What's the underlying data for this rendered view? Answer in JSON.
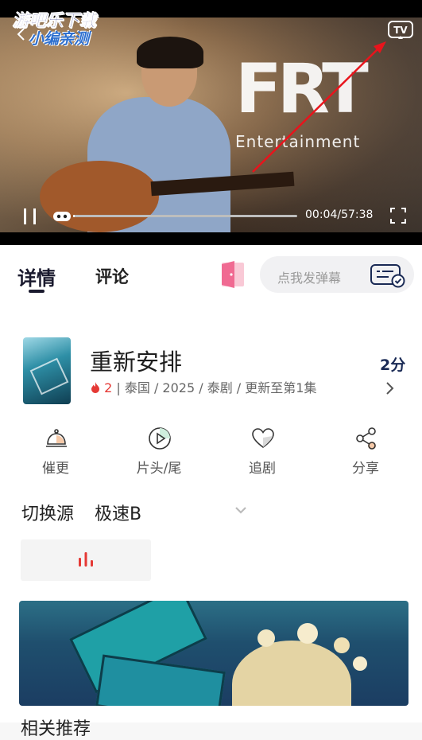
{
  "watermark": {
    "line1": "游吧乐下载",
    "line2": "小编亲测"
  },
  "video": {
    "logo_text": "FRT",
    "logo_subtext": "Entertainment",
    "time": "00:04/57:38",
    "progress_fraction": 0.0012,
    "tv_label": "TV"
  },
  "tabs": {
    "detail": "详情",
    "comment": "评论"
  },
  "danmaku": {
    "placeholder": "点我发弹幕"
  },
  "show": {
    "title": "重新安排",
    "score": "2分",
    "hot_count": "2",
    "meta": "| 泰国 / 2025 / 泰剧 / 更新至第1集"
  },
  "actions": [
    {
      "label": "催更",
      "icon": "bell-icon"
    },
    {
      "label": "片头/尾",
      "icon": "play-circle-icon"
    },
    {
      "label": "追剧",
      "icon": "heart-icon"
    },
    {
      "label": "分享",
      "icon": "share-icon"
    }
  ],
  "source": {
    "label": "切换源",
    "value": "极速B"
  },
  "section_heading": "相关推荐",
  "colors": {
    "accent": "#e53935",
    "dark": "#1a1a2e",
    "arrow": "#e8141c"
  }
}
